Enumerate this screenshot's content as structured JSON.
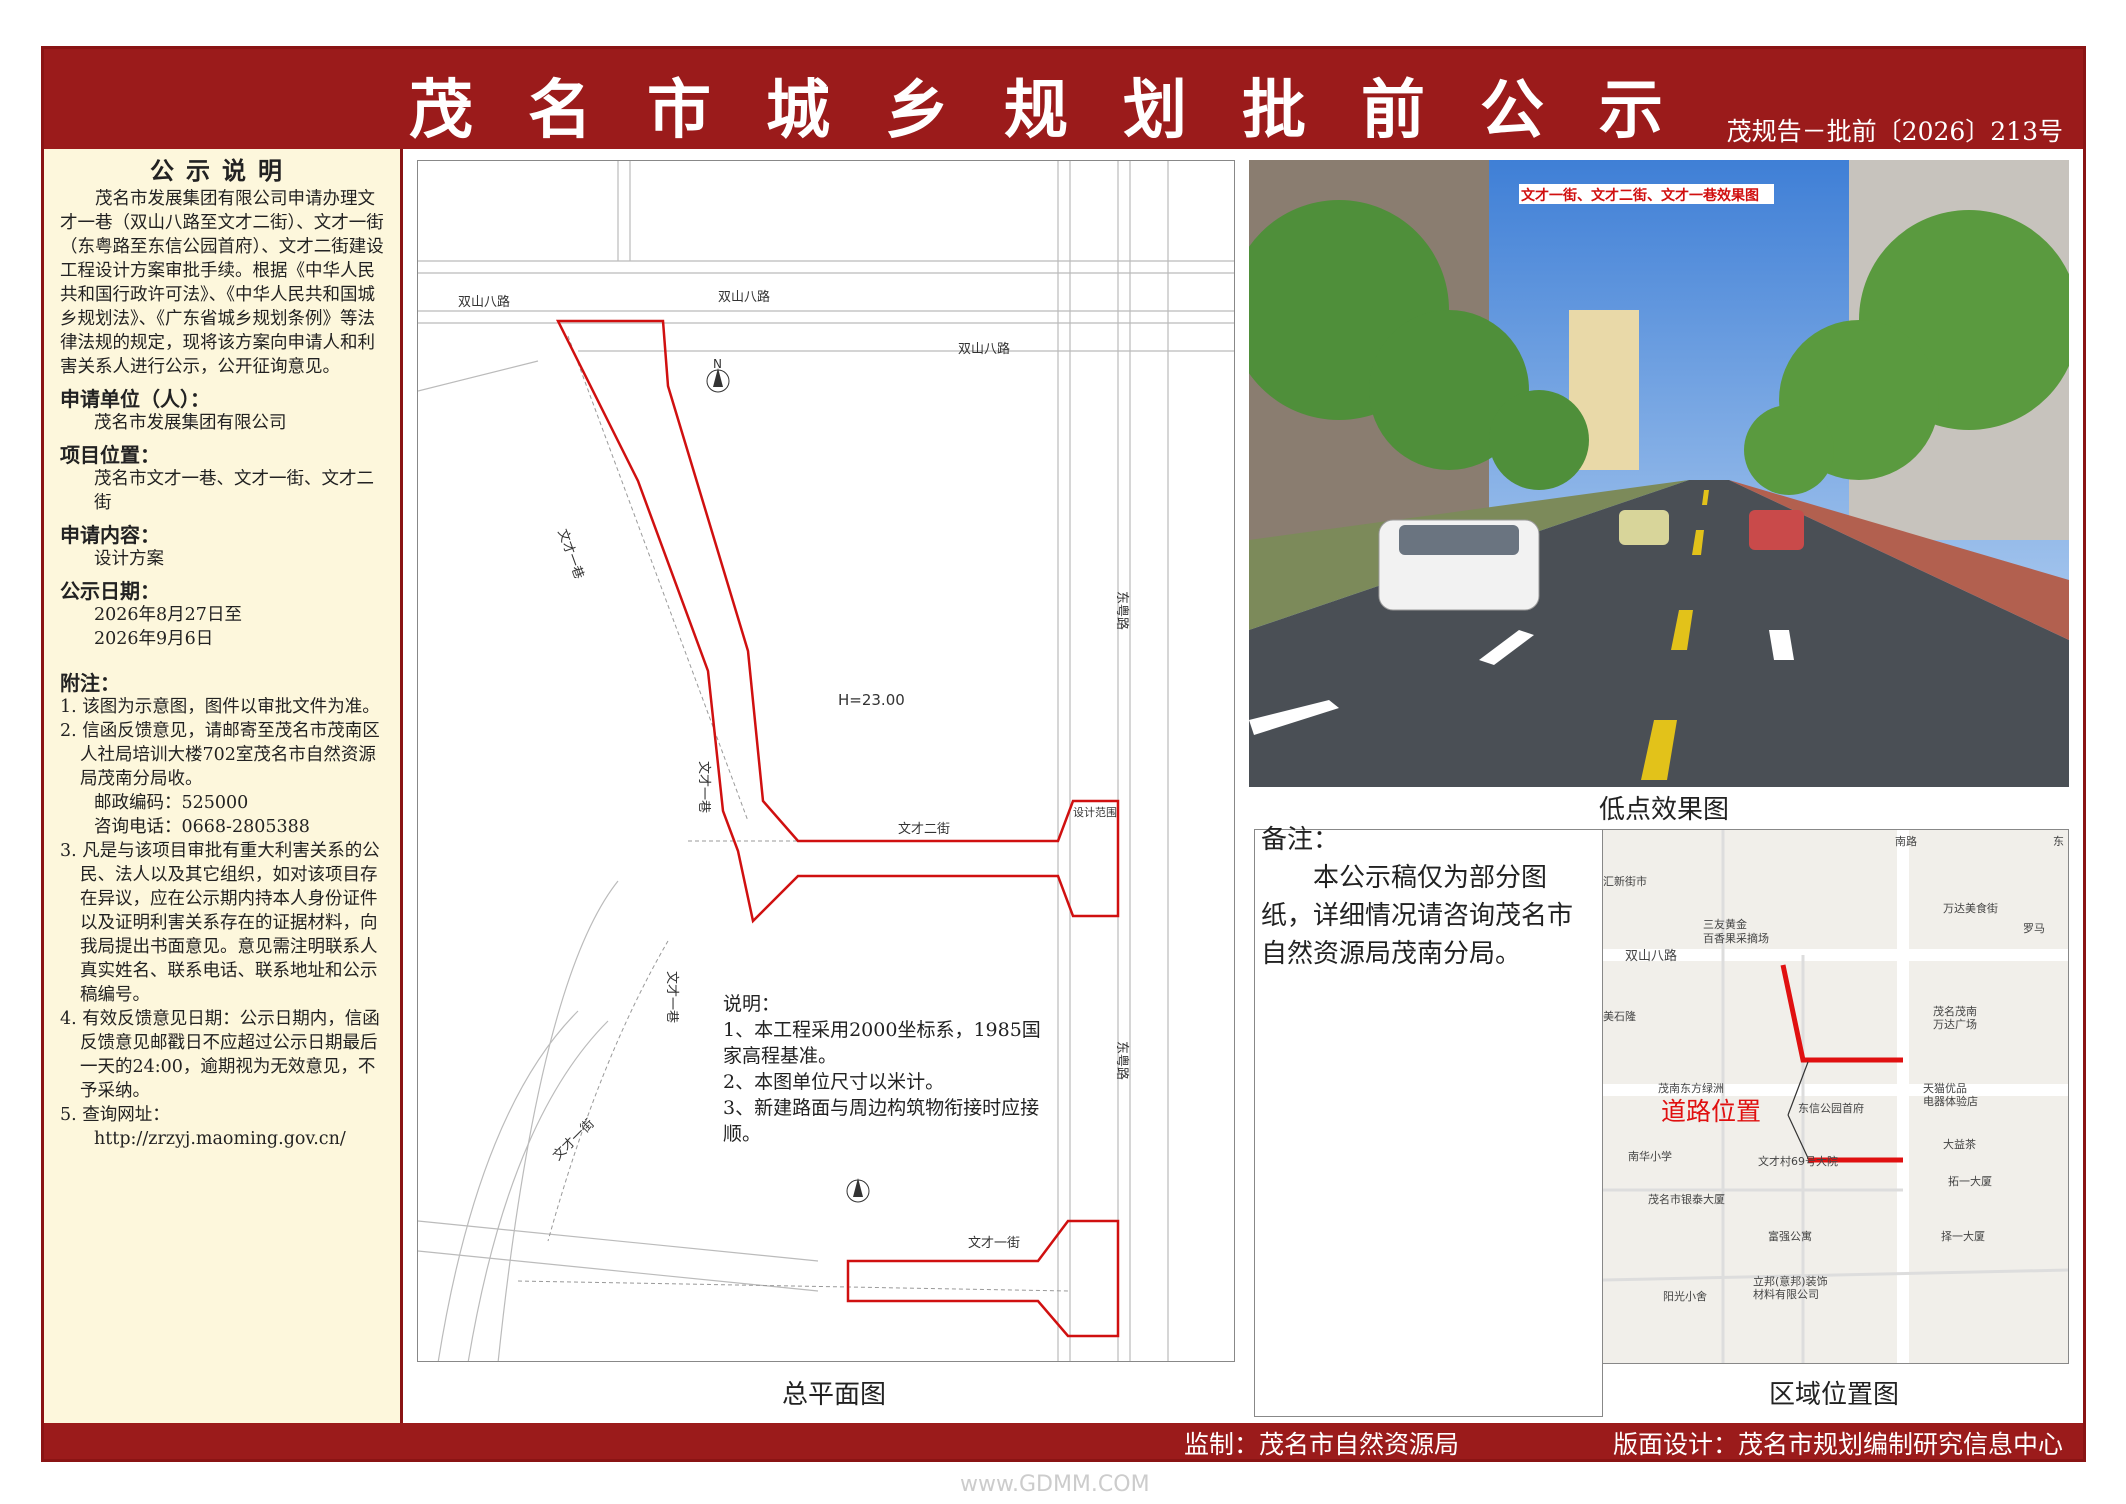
{
  "header": {
    "title": "茂名市城乡规划批前公示",
    "doc_no": "茂规告－批前〔2026〕213号"
  },
  "notice": {
    "heading": "公示说明",
    "body": "茂名市发展集团有限公司申请办理文才一巷（双山八路至文才二街）、文才一街（东粤路至东信公园首府）、文才二街建设工程设计方案审批手续。根据《中华人民共和国行政许可法》、《中华人民共和国城乡规划法》、《广东省城乡规划条例》等法律法规的规定，现将该方案向申请人和利害关系人进行公示，公开征询意见。",
    "applicant_label": "申请单位（人）：",
    "applicant": "茂名市发展集团有限公司",
    "location_label": "项目位置：",
    "location": "茂名市文才一巷、文才一街、文才二街",
    "content_label": "申请内容：",
    "content": "设计方案",
    "date_label": "公示日期：",
    "date_from": "2026年8月27日至",
    "date_to": "2026年9月6日",
    "notes_title": "附注：",
    "note1": "1. 该图为示意图，图件以审批文件为准。",
    "note2": "2. 信函反馈意见，请邮寄至茂名市茂南区人社局培训大楼702室茂名市自然资源局茂南分局收。",
    "postcode": "邮政编码：525000",
    "phone": "咨询电话：0668-2805388",
    "note3": "3. 凡是与该项目审批有重大利害关系的公民、法人以及其它组织，如对该项目存在异议，应在公示期内持本人身份证件以及证明利害关系存在的证据材料，向我局提出书面意见。意见需注明联系人真实姓名、联系电话、联系地址和公示稿编号。",
    "note4": "4. 有效反馈意见日期：公示日期内，信函反馈意见邮戳日不应超过公示日期最后一天的24:00，逾期视为无效意见，不予采纳。",
    "note5": "5. 查询网址：",
    "url": "http://zrzyj.maoming.gov.cn/"
  },
  "plan": {
    "caption": "总平面图",
    "explain_title": "说明：",
    "explain1": "1、本工程采用2000坐标系，1985国家高程基准。",
    "explain2": "2、本图单位尺寸以米计。",
    "explain3": "3、新建路面与周边构筑物衔接时应接顺。",
    "labels": {
      "shuangshan1": "双山八路",
      "shuangshan2": "双山八路",
      "shuangshan3": "双山八路",
      "xiang": "文才一巷",
      "xiang2": "文才一巷",
      "xiang3": "文才一巷",
      "erjie": "文才二街",
      "yijie": "文才一街",
      "yijie2": "文才一街",
      "dongyue": "东粤路",
      "dongyue2": "东粤路",
      "sjfw": "设计范围",
      "h": "H=23.00",
      "north": "N"
    }
  },
  "render": {
    "caption": "低点效果图",
    "banner": "文才一街、文才二街、文才一巷效果图"
  },
  "remarks": {
    "title": "备注：",
    "text": "本公示稿仅为部分图纸，详细情况请咨询茂名市自然资源局茂南分局。"
  },
  "location_map": {
    "caption": "区域位置图",
    "marker_label": "道路位置",
    "pois": [
      "汇新街市",
      "三友黄金",
      "百香果采摘场",
      "双山八路",
      "万达美食街",
      "罗马",
      "茂名茂南",
      "万达广场",
      "美石隆",
      "天猫优品",
      "电器体验店",
      "茂南东方绿洲",
      "东信公园首府",
      "大益茶",
      "南华小学",
      "文才村69号大院",
      "拓一大厦",
      "茂名市银泰大厦",
      "富强公寓",
      "择一大厦",
      "立邦(意邦)装饰",
      "材料有限公司",
      "阳光小舍",
      "南路",
      "东"
    ]
  },
  "footer": {
    "supervisor": "监制：茂名市自然资源局",
    "designer": "版面设计：茂名市规划编制研究信息中心"
  },
  "watermark": "www.GDMM.COM"
}
